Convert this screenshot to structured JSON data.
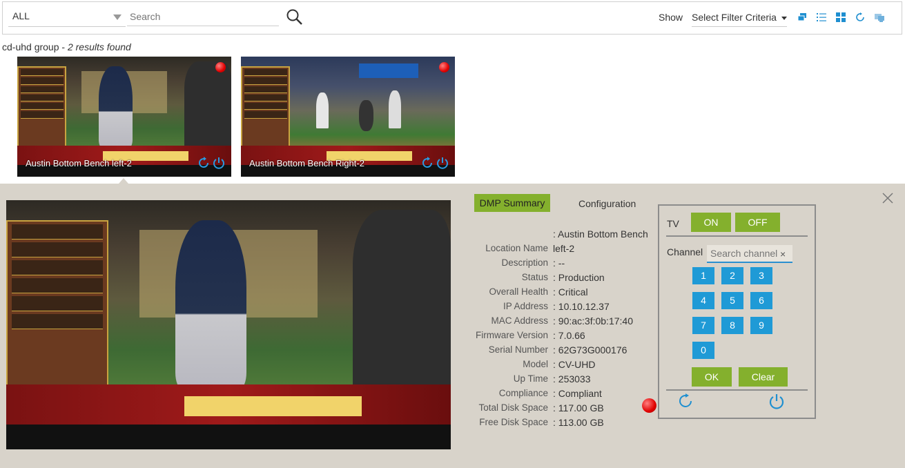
{
  "toolbar": {
    "group_select": "ALL",
    "search_placeholder": "Search",
    "show_label": "Show",
    "filter_select": "Select Filter Criteria",
    "icons": [
      "stack-view-icon",
      "list-view-icon",
      "grid-view-icon",
      "refresh-icon",
      "display-icon"
    ]
  },
  "results": {
    "group": "cd-uhd group",
    "separator": " - ",
    "count_text": "2 results found"
  },
  "thumbnails": [
    {
      "label": "Austin Bottom Bench left-2",
      "status": "red"
    },
    {
      "label": "Austin Bottom Bench Right-2",
      "status": "red"
    }
  ],
  "detail": {
    "tabs": {
      "summary": "DMP Summary",
      "config": "Configuration"
    },
    "fields": [
      {
        "key": "",
        "value": ": Austin Bottom Bench"
      },
      {
        "key": "Location Name",
        "value": "left-2"
      },
      {
        "key": "Description",
        "value": ": --"
      },
      {
        "key": "Status",
        "value": ": Production"
      },
      {
        "key": "Overall Health",
        "value": ": Critical"
      },
      {
        "key": "IP Address",
        "value": ": 10.10.12.37"
      },
      {
        "key": "MAC Address",
        "value": ": 90:ac:3f:0b:17:40"
      },
      {
        "key": "Firmware Version",
        "value": ": 7.0.66"
      },
      {
        "key": "Serial Number",
        "value": ": 62G73G000176"
      },
      {
        "key": "Model",
        "value": ": CV-UHD"
      },
      {
        "key": "Up Time",
        "value": ": 253033"
      },
      {
        "key": "Compliance",
        "value": ": Compliant"
      },
      {
        "key": "Total Disk Space",
        "value": ": 117.00 GB"
      },
      {
        "key": "Free Disk Space",
        "value": ": 113.00 GB"
      }
    ],
    "remote": {
      "tv_label": "TV",
      "on": "ON",
      "off": "OFF",
      "channel_label": "Channel",
      "channel_placeholder": "Search channel",
      "clear_x": "×",
      "keys": [
        "1",
        "2",
        "3",
        "4",
        "5",
        "6",
        "7",
        "8",
        "9",
        "0"
      ],
      "ok": "OK",
      "clear": "Clear"
    },
    "colors": {
      "accent_green": "#84b02d",
      "key_blue": "#1f9ad6",
      "status_red": "#e00000",
      "panel_bg": "#d8d3ca"
    }
  }
}
